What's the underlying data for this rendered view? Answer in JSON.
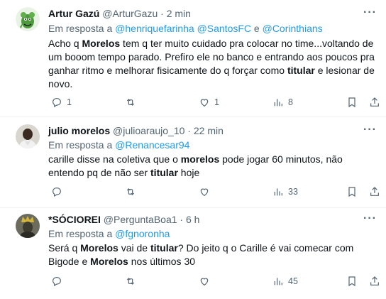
{
  "tweets": [
    {
      "name": "Artur Gazú",
      "handle": "@ArturGazu",
      "sep": "·",
      "time": "2 min",
      "reply_prefix": "Em resposta a",
      "mentions": [
        "@henriquefarinha",
        "@SantosFC",
        "@Corinthians"
      ],
      "mention_joiner": "e",
      "text": [
        "Acho q ",
        "Morelos",
        " tem q ter muito cuidado pra colocar no time...voltando de um booom tempo parado. Prefiro ele no banco e entrando aos poucos pra ganhar ritmo e melhorar fisicamente do q forçar como ",
        "titular",
        " e lesionar de novo."
      ],
      "replies": "1",
      "retweets": "",
      "likes": "1",
      "views": "8",
      "avatar_icon": "green-monster-avatar"
    },
    {
      "name": "julio morelos",
      "handle": "@julioaraujo_10",
      "sep": "·",
      "time": "22 min",
      "reply_prefix": "Em resposta a",
      "mention": "@Renancesar94",
      "text": [
        "carille disse na coletiva que o ",
        "morelos",
        " pode jogar 60 minutos, não entendo pq de não ser ",
        "titular",
        " hoje"
      ],
      "replies": "",
      "retweets": "",
      "likes": "",
      "views": "33",
      "avatar_icon": "person-photo-avatar"
    },
    {
      "name": "*SÓCIOREI",
      "handle": "@PerguntaBoa1",
      "sep": "·",
      "time": "6 h",
      "reply_prefix": "Em resposta a",
      "mention": "@fgnoronha",
      "text": [
        "Será q ",
        "Morelos",
        " vai de ",
        "titular",
        "? Do jeito q o Carille é vai comecar com Bigode e ",
        "Morelos",
        " nos últimos 30"
      ],
      "replies": "",
      "retweets": "",
      "likes": "",
      "views": "45",
      "avatar_icon": "crowned-person-avatar"
    }
  ],
  "icons": {
    "more": "more-icon",
    "reply": "reply-icon",
    "retweet": "retweet-icon",
    "like": "like-icon",
    "views": "views-icon",
    "bookmark": "bookmark-icon",
    "share": "share-icon"
  },
  "colors": {
    "link": "#1d9bf0",
    "muted": "#536471",
    "text": "#0f1419",
    "divider": "#eff3f4"
  }
}
